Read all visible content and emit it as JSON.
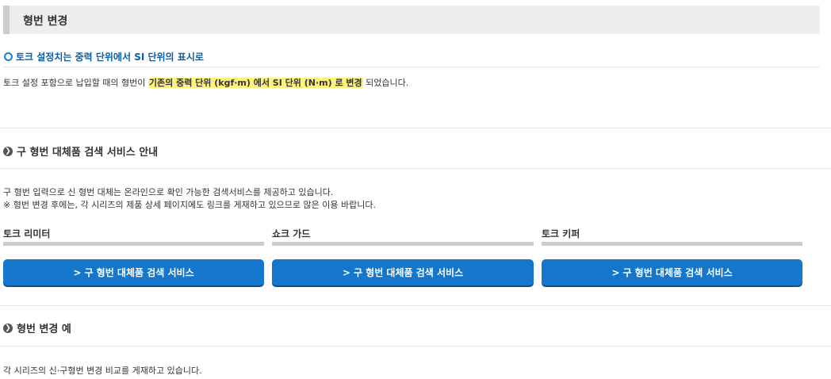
{
  "page_title": "형번 변경",
  "torque_section": {
    "heading": "토크 설정치는 중력 단위에서 SI 단위의 표시로",
    "text_before": "토크 설정 포함으로 납입할 때의 형번이 ",
    "highlight": "기존의 중력 단위 (kgf·m) 에서 SI 단위 (N·m) 로 변경",
    "text_after": " 되었습니다."
  },
  "search_section": {
    "heading": "구 형번 대체품 검색 서비스 안내",
    "line1": "구 형번 입력으로 신 형번 대체는 온라인으로 확인 가능한 검색서비스를 제공하고 있습니다.",
    "line2": "※ 형번 변경 후에는, 각 시리즈의 제품 상세 페이지에도 링크를 게재하고 있으므로 많은 이용 바랍니다.",
    "columns": [
      {
        "label": "토크 리미터",
        "button": "구 형번 대체품 검색 서비스"
      },
      {
        "label": "쇼크 가드",
        "button": "구 형번 대체품 검색 서비스"
      },
      {
        "label": "토크 키퍼",
        "button": "구 형번 대체품 검색 서비스"
      }
    ]
  },
  "example_section": {
    "heading": "형번 변경 예",
    "text": "각 시리즈의 신·구형번 변경 비교를 게재하고 있습니다."
  },
  "icons": {
    "bullet": "ring-bullet-icon",
    "section": "arrow-circle-icon",
    "button": "chevron-right-icon"
  },
  "colors": {
    "accent_blue": "#1477cc",
    "heading_blue": "#0a5fa8",
    "highlight_yellow": "#fff27a"
  }
}
